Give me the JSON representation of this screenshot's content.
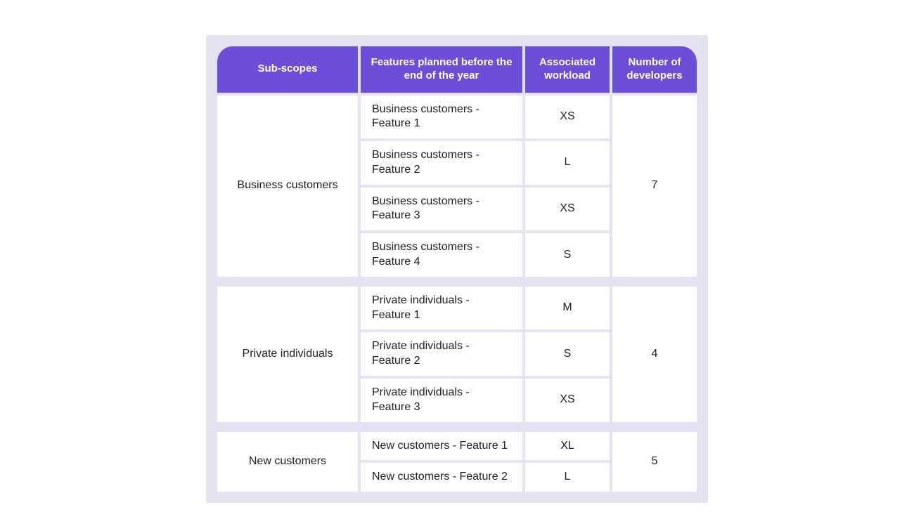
{
  "headers": {
    "sub": "Sub-scopes",
    "feat": "Features planned before the end of the year",
    "work": "Associated workload",
    "dev": "Number of developers"
  },
  "groups": [
    {
      "sub": "Business customers",
      "dev": "7",
      "features": [
        {
          "name": "Business customers - Feature 1",
          "workload": "XS"
        },
        {
          "name": "Business customers - Feature 2",
          "workload": "L"
        },
        {
          "name": "Business customers - Feature 3",
          "workload": "XS"
        },
        {
          "name": "Business customers - Feature 4",
          "workload": "S"
        }
      ]
    },
    {
      "sub": "Private individuals",
      "dev": "4",
      "features": [
        {
          "name": "Private individuals - Feature 1",
          "workload": "M"
        },
        {
          "name": "Private individuals - Feature 2",
          "workload": "S"
        },
        {
          "name": "Private individuals - Feature 3",
          "workload": "XS"
        }
      ]
    },
    {
      "sub": "New customers",
      "dev": "5",
      "features": [
        {
          "name": "New customers - Feature 1",
          "workload": "XL"
        },
        {
          "name": "New customers - Feature 2",
          "workload": "L"
        }
      ]
    }
  ]
}
